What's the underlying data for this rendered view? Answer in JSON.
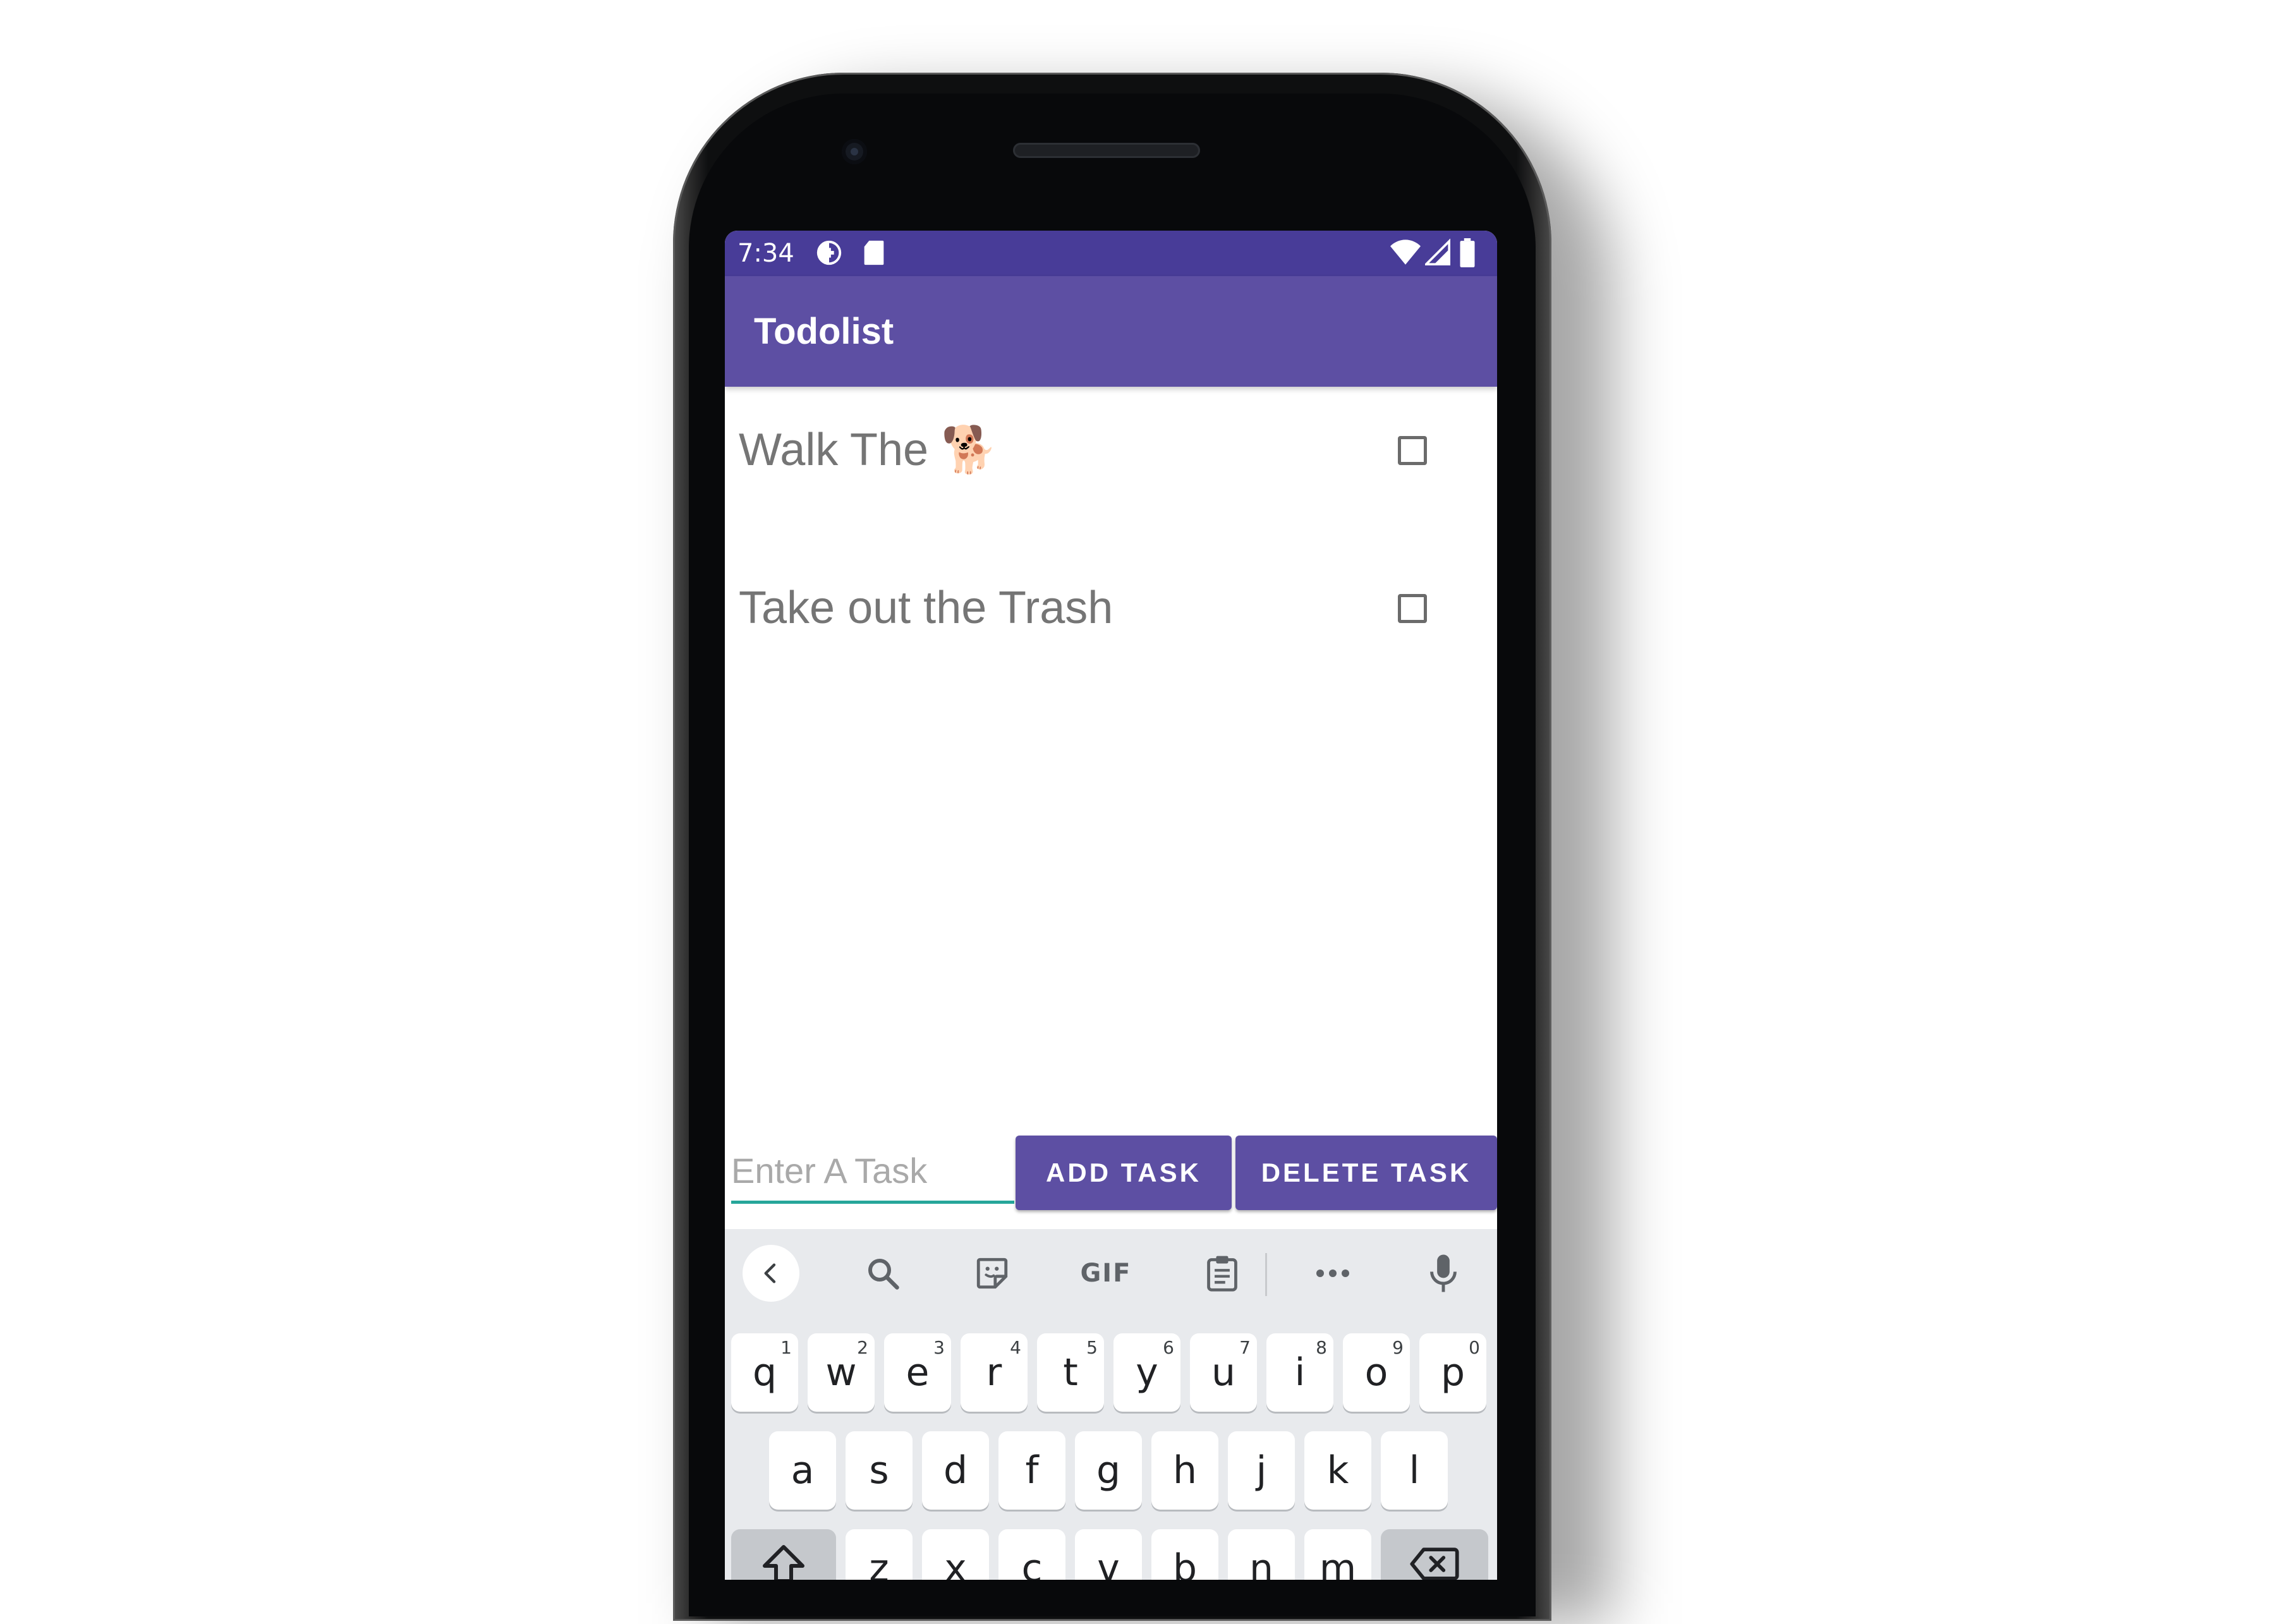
{
  "status_bar": {
    "time": "7:34",
    "left_icons": [
      "data-saver-icon",
      "sd-card-icon"
    ],
    "right_icons": [
      "wifi-icon",
      "cell-signal-icon",
      "battery-icon"
    ]
  },
  "app_bar": {
    "title": "Todolist"
  },
  "tasks": [
    {
      "text": "Walk The 🐕",
      "checked": false
    },
    {
      "text": "Take out the Trash",
      "checked": false
    }
  ],
  "input": {
    "placeholder": "Enter A Task",
    "value": ""
  },
  "buttons": {
    "add": "ADD TASK",
    "delete": "DELETE TASK"
  },
  "keyboard": {
    "toolbar": {
      "items": [
        "back-icon",
        "search-icon",
        "sticker-icon",
        "gif-icon",
        "clipboard-icon",
        "more-icon",
        "mic-icon"
      ],
      "gif_label": "GIF",
      "more_label": "•••"
    },
    "row1": [
      {
        "k": "q",
        "h": "1"
      },
      {
        "k": "w",
        "h": "2"
      },
      {
        "k": "e",
        "h": "3"
      },
      {
        "k": "r",
        "h": "4"
      },
      {
        "k": "t",
        "h": "5"
      },
      {
        "k": "y",
        "h": "6"
      },
      {
        "k": "u",
        "h": "7"
      },
      {
        "k": "i",
        "h": "8"
      },
      {
        "k": "o",
        "h": "9"
      },
      {
        "k": "p",
        "h": "0"
      }
    ],
    "row2": [
      "a",
      "s",
      "d",
      "f",
      "g",
      "h",
      "j",
      "k",
      "l"
    ],
    "row3": [
      "z",
      "x",
      "c",
      "v",
      "b",
      "n",
      "m"
    ],
    "shift_icon": "shift-icon",
    "backspace_icon": "backspace-icon"
  },
  "colors": {
    "status_bar": "#483c98",
    "app_bar": "#5d4fa3",
    "accent_underline": "#26a69a",
    "keyboard_bg": "#e8eaed"
  }
}
